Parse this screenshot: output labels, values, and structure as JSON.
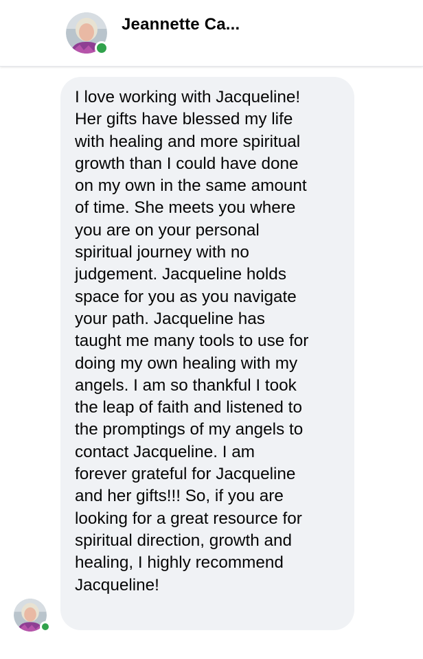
{
  "header": {
    "contact_name": "Jeannette Ca...",
    "status": "online",
    "avatar_icon": "user-avatar",
    "status_color": "#31a24c"
  },
  "message": {
    "text": "I love working with Jacqueline!\nHer gifts have blessed my life\nwith healing and more spiritual\ngrowth than I could have done\non my own in the same amount\nof time.  She meets you where\nyou are on your personal\nspiritual journey with no\njudgement.  Jacqueline holds\nspace for you as you navigate\nyour path.  Jacqueline has\ntaught me many tools to use for\ndoing my own healing with my\nangels.  I am so thankful I took\nthe leap of faith and listened to\nthe promptings of my angels to\ncontact Jacqueline.  I am\nforever grateful for Jacqueline\nand her gifts!!!  So, if you are\nlooking for a great resource for\nspiritual direction, growth and\nhealing, I highly recommend\nJacqueline!",
    "bubble_color": "#f0f2f5"
  }
}
